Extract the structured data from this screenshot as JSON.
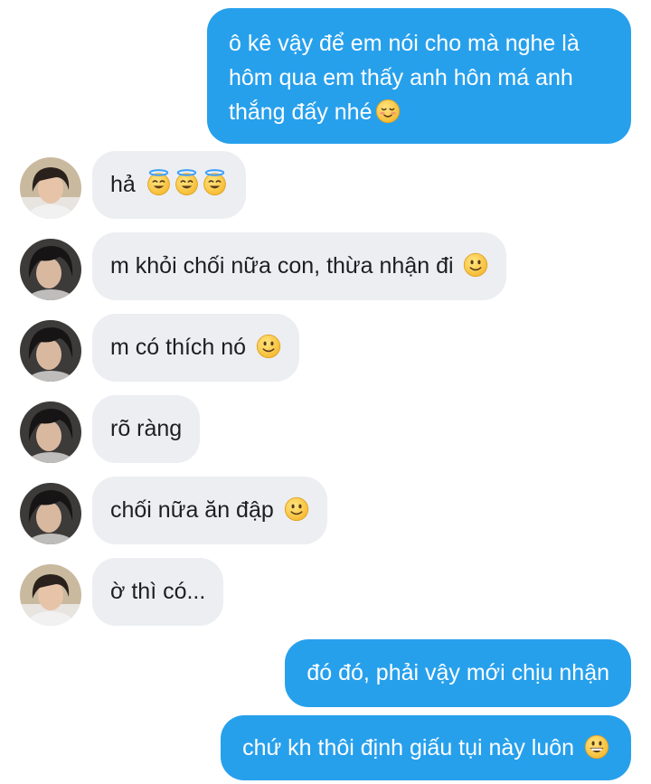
{
  "messages": [
    {
      "id": "m1",
      "direction": "outgoing",
      "lines": [
        "ô kê vậy để em nói cho mà nghe là",
        "hôm qua em thấy anh hôn má anh",
        "thắng đấy nhé"
      ],
      "emoji": [
        "relieved-blush"
      ]
    },
    {
      "id": "m2",
      "direction": "incoming",
      "text": "hả",
      "emoji": [
        "halo-smile",
        "halo-smile",
        "halo-smile"
      ],
      "avatar": "avatar-a"
    },
    {
      "id": "m3",
      "direction": "incoming",
      "text": "m khỏi chối nữa con, thừa nhận đi",
      "emoji": [
        "slight-smile"
      ],
      "avatar": "avatar-b"
    },
    {
      "id": "m4",
      "direction": "incoming",
      "text": "m có thích nó",
      "emoji": [
        "slight-smile"
      ],
      "avatar": "avatar-b"
    },
    {
      "id": "m5",
      "direction": "incoming",
      "text": "rõ ràng",
      "emoji": [],
      "avatar": "avatar-b"
    },
    {
      "id": "m6",
      "direction": "incoming",
      "text": "chối nữa ăn đập",
      "emoji": [
        "slight-smile"
      ],
      "avatar": "avatar-b"
    },
    {
      "id": "m7",
      "direction": "incoming",
      "text": "ờ thì có...",
      "emoji": [],
      "avatar": "avatar-a"
    },
    {
      "id": "m8",
      "direction": "outgoing",
      "text": "đó đó, phải vậy mới chịu nhận",
      "emoji": []
    },
    {
      "id": "m9",
      "direction": "outgoing",
      "text": "chứ kh thôi định giấu tụi này luôn",
      "emoji": [
        "grin"
      ]
    }
  ],
  "colors": {
    "outgoing_bubble": "#27a0ec",
    "incoming_bubble": "#eceef1",
    "outgoing_text": "#ffffff",
    "incoming_text": "#1c1e21",
    "emoji_face": "#f8c53a"
  }
}
